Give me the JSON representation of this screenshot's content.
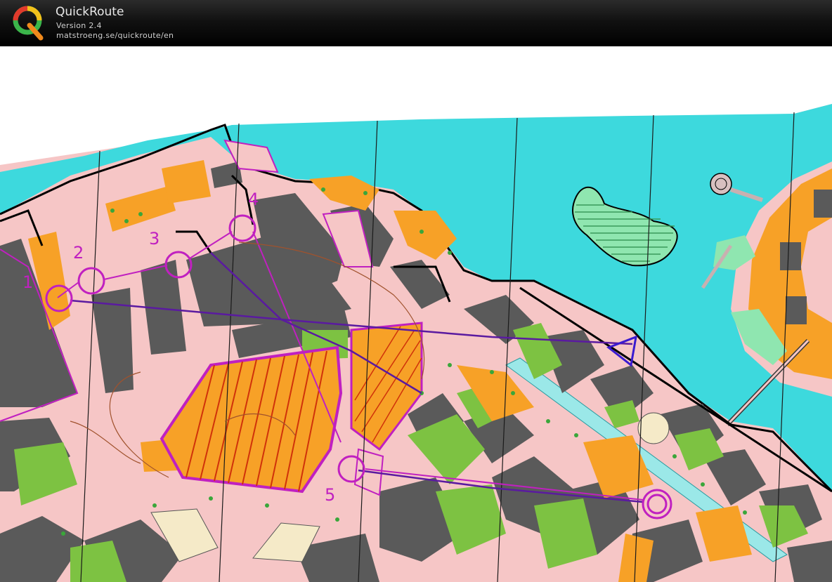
{
  "app": {
    "name": "QuickRoute",
    "version": "Version 2.4",
    "url": "matstroeng.se/quickroute/en",
    "logo_icon": "quickroute-q-logo-icon"
  },
  "map": {
    "controls": [
      {
        "label": "1"
      },
      {
        "label": "2"
      },
      {
        "label": "3"
      },
      {
        "label": "4"
      },
      {
        "label": "5"
      }
    ],
    "colors": {
      "water": "#3dd9dd",
      "paved_area": "#f6c6c6",
      "building": "#5a5a5a",
      "vegetation": "#7dc242",
      "open_land": "#f7a127",
      "course": "#c020c0",
      "route": "#5a1aa0"
    }
  }
}
